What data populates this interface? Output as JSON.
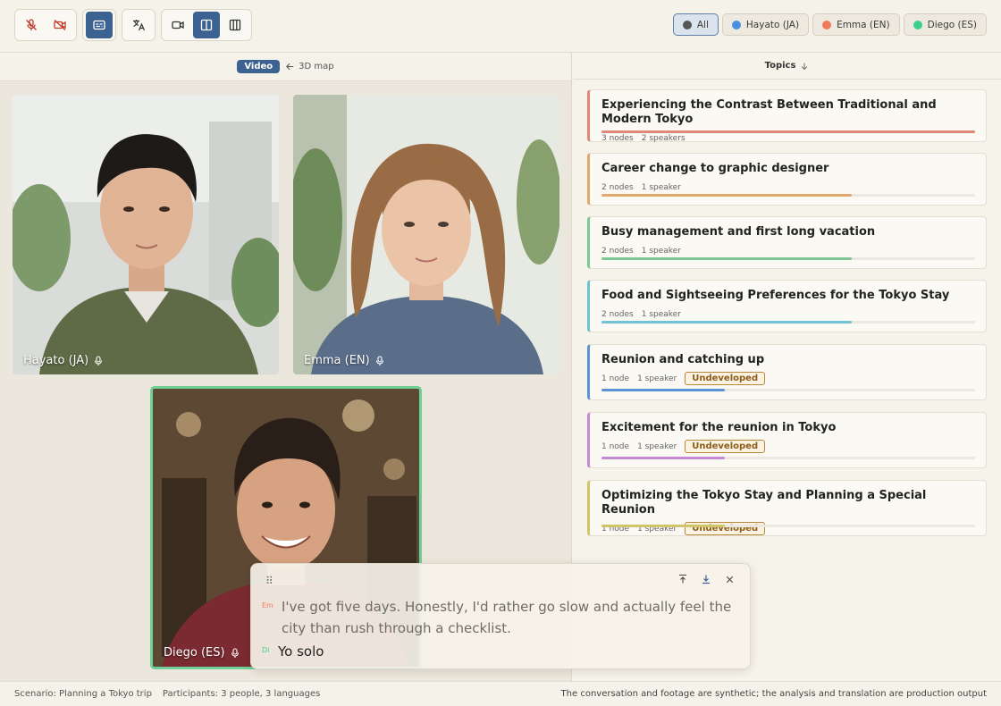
{
  "toolbar": {
    "groups": [
      {
        "buttons": [
          {
            "icon": "mic-off-icon"
          },
          {
            "icon": "camera-off-icon"
          }
        ]
      },
      {
        "buttons": [
          {
            "icon": "captions-icon",
            "active": true
          }
        ]
      },
      {
        "buttons": [
          {
            "icon": "translate-icon"
          }
        ]
      },
      {
        "buttons": [
          {
            "icon": "video-icon"
          },
          {
            "icon": "panel-split-icon",
            "active": true
          },
          {
            "icon": "columns-icon"
          }
        ]
      }
    ],
    "filters": [
      {
        "label": "All",
        "color": "#555555",
        "active": true
      },
      {
        "label": "Hayato (JA)",
        "color": "#4a90e2"
      },
      {
        "label": "Emma (EN)",
        "color": "#ef7a5a"
      },
      {
        "label": "Diego (ES)",
        "color": "#3ecf8e"
      }
    ]
  },
  "left": {
    "view_pill": "Video",
    "back_label": "3D map",
    "tiles": [
      {
        "name": "Hayato (JA)"
      },
      {
        "name": "Emma (EN)"
      },
      {
        "name": "Diego (ES)",
        "speaking": true
      }
    ]
  },
  "right": {
    "header": "Topics",
    "topics": [
      {
        "title": "Experiencing the Contrast Between Traditional and Modern Tokyo",
        "nodes": "3 nodes",
        "speakers": "2 speakers",
        "badge": "",
        "color": "#e0877a",
        "progress": 1.0
      },
      {
        "title": "Career change to graphic designer",
        "nodes": "2 nodes",
        "speakers": "1 speaker",
        "badge": "",
        "color": "#e0a86a",
        "progress": 0.67
      },
      {
        "title": "Busy management and first long vacation",
        "nodes": "2 nodes",
        "speakers": "1 speaker",
        "badge": "",
        "color": "#7cc796",
        "progress": 0.67
      },
      {
        "title": "Food and Sightseeing Preferences for the Tokyo Stay",
        "nodes": "2 nodes",
        "speakers": "1 speaker",
        "badge": "",
        "color": "#6fc3d4",
        "progress": 0.67
      },
      {
        "title": "Reunion and catching up",
        "nodes": "1 node",
        "speakers": "1 speaker",
        "badge": "Undeveloped",
        "color": "#5b93d6",
        "progress": 0.33
      },
      {
        "title": "Excitement for the reunion in Tokyo",
        "nodes": "1 node",
        "speakers": "1 speaker",
        "badge": "Undeveloped",
        "color": "#c58ad4",
        "progress": 0.33
      },
      {
        "title": "Optimizing the Tokyo Stay and Planning a Special Reunion",
        "nodes": "1 node",
        "speakers": "1 speaker",
        "badge": "Undeveloped",
        "color": "#cfc66a",
        "progress": 0.33
      }
    ]
  },
  "subtitles": {
    "lines": [
      {
        "tag": "Em",
        "tag_color": "#ef7a5a",
        "text": "I've got five days. Honestly, I'd rather go slow and actually feel the city than rush through a checklist.",
        "faded": true
      },
      {
        "tag": "Di",
        "tag_color": "#3ecf8e",
        "text": "Yo solo",
        "faded": false
      }
    ]
  },
  "footer": {
    "scenario": "Scenario: Planning a Tokyo trip",
    "participants": "Participants: 3 people, 3 languages",
    "note": "The conversation and footage are synthetic; the analysis and translation are production output"
  }
}
